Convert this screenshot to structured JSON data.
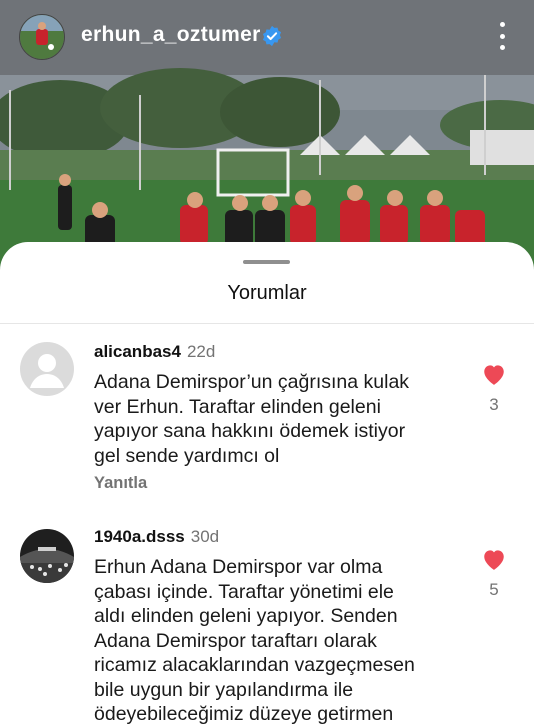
{
  "post": {
    "username": "erhun_a_oztumer",
    "verified_icon": "verified-badge-icon",
    "more_icon": "more-vertical-icon"
  },
  "sheet": {
    "title": "Yorumlar"
  },
  "comments": [
    {
      "username": "alicanbas4",
      "time": "22d",
      "lines": [
        "Adana Demirspor’un çağrısına kulak",
        "ver Erhun. Taraftar elinden geleni",
        "yapıyor sana hakkını ödemek istiyor",
        "gel sende yardımcı ol"
      ],
      "reply_label": "Yanıtla",
      "likes": "3"
    },
    {
      "username": "1940a.dsss",
      "time": "30d",
      "lines": [
        "Erhun Adana Demirspor var olma",
        "çabası içinde. Taraftar yönetimi ele",
        "aldı elinden geleni yapıyor. Senden",
        "Adana Demirspor taraftarı olarak",
        "ricamız alacaklarından vazgeçmesen",
        "bile uygun bir yapılandırma ile",
        "ödeyebileceğimiz düzeye getirmen"
      ],
      "likes": "5"
    }
  ],
  "colors": {
    "like_red": "#ed4956",
    "verified_blue": "#3897f0",
    "muted_text": "#737373"
  }
}
